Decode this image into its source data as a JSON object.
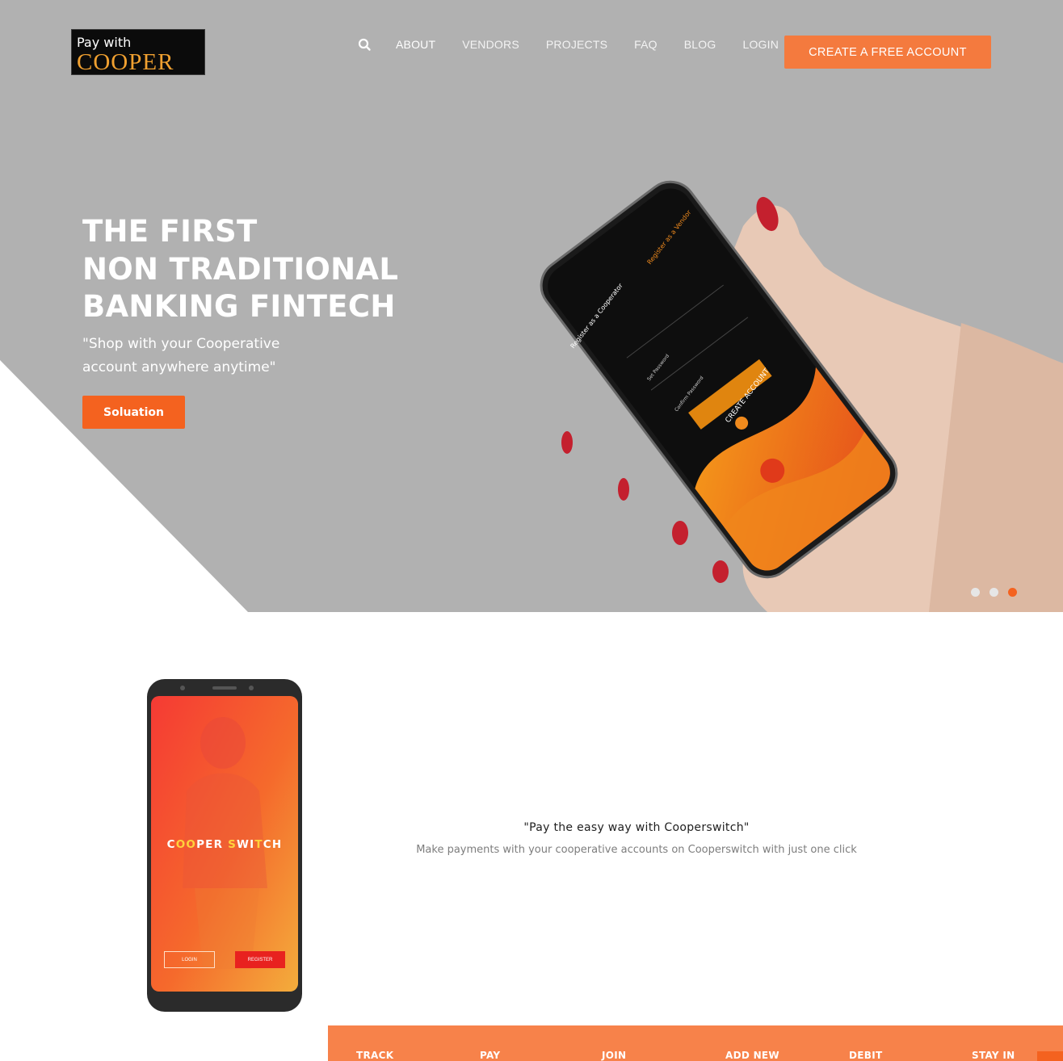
{
  "header": {
    "logo": {
      "line1": "Pay with",
      "line2": "COOPER"
    },
    "nav": {
      "search_icon": "search-icon",
      "items": [
        {
          "label": "ABOUT"
        },
        {
          "label": "VENDORS"
        },
        {
          "label": "PROJECTS"
        },
        {
          "label": "FAQ"
        },
        {
          "label": "BLOG"
        },
        {
          "label": "LOGIN"
        }
      ]
    },
    "cta_label": "CREATE A FREE ACCOUNT"
  },
  "hero": {
    "title_lines": [
      "THE FIRST",
      "NON TRADITIONAL",
      "BANKING FINTECH"
    ],
    "quote_lines": [
      "\"Shop with your Cooperative",
      "account anywhere anytime\""
    ],
    "button_label": "Soluation",
    "phone_screen": {
      "tab_cooperator": "Register as a Cooperator",
      "tab_vendor": "Register as a Vendor",
      "field_password": "Set Password",
      "field_confirm": "Confirm Password",
      "button": "CREATE ACCOUNT"
    },
    "slider": {
      "count": 3,
      "active_index": 2
    }
  },
  "promo": {
    "phone_brand_parts": [
      "C",
      "OO",
      "PER ",
      "S",
      "WI",
      "T",
      "CH"
    ],
    "phone_login": "LOGIN",
    "phone_register": "REGISTER",
    "tagline": "\"Pay the easy way with Cooperswitch\"",
    "subline": "Make payments with your cooperative accounts on Cooperswitch with just one click"
  },
  "features": [
    {
      "label": "TRACK"
    },
    {
      "label": "PAY"
    },
    {
      "label": "JOIN"
    },
    {
      "label": "ADD NEW"
    },
    {
      "label": "DEBIT"
    },
    {
      "label": "STAY IN"
    }
  ],
  "colors": {
    "accent": "#f4621f",
    "accent_soft": "#f47a3e",
    "hero_bg": "#b1b1b1",
    "bar": "#f7824a"
  }
}
